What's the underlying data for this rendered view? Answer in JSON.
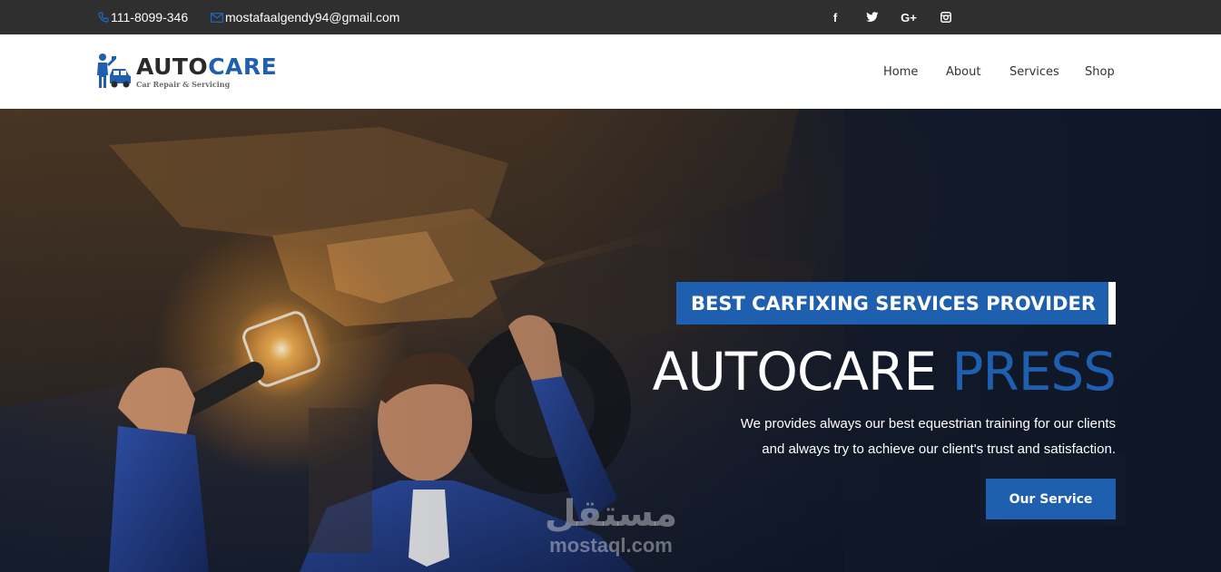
{
  "topbar": {
    "phone_icon": "phone-icon",
    "phone": "111-8099-346",
    "email_icon": "envelope-icon",
    "email": "mostafaalgendy94@gmail.com",
    "social": {
      "facebook": "f",
      "twitter_icon": "twitter-icon",
      "googleplus": "G+",
      "instagram_icon": "instagram-icon"
    }
  },
  "logo": {
    "icon": "mechanic-car-logo-icon",
    "auto": "AUTO",
    "care": "CARE",
    "tagline": "Car Repair & Servicing"
  },
  "nav": {
    "items": [
      {
        "label": "Home"
      },
      {
        "label": "About"
      },
      {
        "label": "Services"
      },
      {
        "label": "Shop"
      }
    ]
  },
  "hero": {
    "badge": "BEST CARFIXING SERVICES PROVIDER",
    "headline_white": "AUTOCARE",
    "headline_blue": "PRESS",
    "description_line1": "We provides always our best equestrian training for our clients",
    "description_line2": "and always try to achieve our client's trust and satisfaction.",
    "cta": "Our Service",
    "image": "mechanic-under-car-image"
  },
  "watermark": {
    "arabic": "مستقل",
    "latin": "mostaql.com"
  },
  "colors": {
    "accent": "#1f5fb0",
    "topbar_bg": "#2f2f2f",
    "header_bg": "#ffffff"
  }
}
